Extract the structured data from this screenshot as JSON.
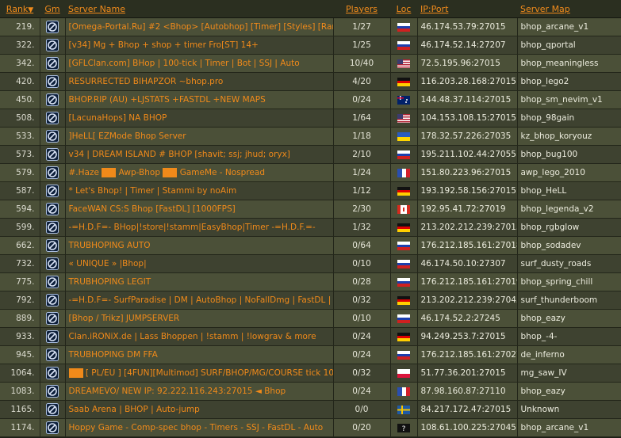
{
  "header": {
    "rank": "Rank",
    "rank_sort": "▼",
    "gm": "Gm",
    "name": "Server Name",
    "players": "Players",
    "loc": "Loc",
    "ip": "IP:Port",
    "map": "Server Map"
  },
  "flag_colors": {
    "ru": [
      "#ffffff",
      "#1c3fae",
      "#d02020"
    ],
    "us": [
      "#b22234",
      "#ffffff",
      "#3c3b6e"
    ],
    "de": [
      "#111111",
      "#dd0000",
      "#ffce00"
    ],
    "au": [
      "#012169",
      "#ffffff",
      "#e4002b"
    ],
    "ua": [
      "#2a5cbf",
      "#ffd500"
    ],
    "fr": [
      "#2a4fb0",
      "#ffffff",
      "#d3202a"
    ],
    "ca": [
      "#d52b1e",
      "#ffffff"
    ],
    "pl": [
      "#ffffff",
      "#dc143c"
    ],
    "se": [
      "#1f5aa6",
      "#f5c400"
    ],
    "unknown": [
      "#111111",
      "#ffffff"
    ]
  },
  "rows": [
    {
      "rank": "219.",
      "name": "[Omega-Portal.Ru] #2 <Bhop> [Autobhop] [Timer] [Styles] [Ranks]",
      "players": "1/27",
      "flag": "ru",
      "ip": "46.174.53.79:27015",
      "map": "bhop_arcane_v1"
    },
    {
      "rank": "322.",
      "name": "[v34] Mg + Bhop + shop + timer Fro[ST] 14+",
      "players": "1/25",
      "flag": "ru",
      "ip": "46.174.52.14:27207",
      "map": "bhop_qportal"
    },
    {
      "rank": "342.",
      "name": "[GFLClan.com] BHop | 100-tick | Timer | Bot | SSJ | Auto",
      "players": "10/40",
      "flag": "us",
      "ip": "72.5.195.96:27015",
      "map": "bhop_meaningless"
    },
    {
      "rank": "420.",
      "name": "RESURRECTED BIHAPZOR ~bhop.pro",
      "players": "4/20",
      "flag": "de",
      "ip": "116.203.28.168:27015",
      "map": "bhop_lego2"
    },
    {
      "rank": "450.",
      "name": "BHOP.RIP (AU) +LJSTATS +FASTDL +NEW MAPS",
      "players": "0/24",
      "flag": "au",
      "ip": "144.48.37.114:27015",
      "map": "bhop_sm_nevim_v1"
    },
    {
      "rank": "508.",
      "name": "[LacunaHops] NA BHOP",
      "players": "1/64",
      "flag": "us",
      "ip": "104.153.108.15:27015",
      "map": "bhop_98gain"
    },
    {
      "rank": "533.",
      "name": "]HeLL[ EZMode Bhop Server",
      "players": "1/18",
      "flag": "ua",
      "ip": "178.32.57.226:27035",
      "map": "kz_bhop_koryouz"
    },
    {
      "rank": "573.",
      "name": "v34 | DREAM ISLAND # BHOP [shavit; ssj; jhud; oryx]",
      "players": "2/10",
      "flag": "ru",
      "ip": "195.211.102.44:27055",
      "map": "bhop_bug100"
    },
    {
      "rank": "579.",
      "name": "#.Haze",
      "name_mid": "Awp-Bhop",
      "name_end": "GameMe - Nospread",
      "players": "1/24",
      "flag": "fr",
      "ip": "151.80.223.96:27015",
      "map": "awp_lego_2010"
    },
    {
      "rank": "587.",
      "name": "* Let's Bhop! | Timer | Stammi by noAim",
      "players": "1/12",
      "flag": "de",
      "ip": "193.192.58.156:27015",
      "map": "bhop_HeLL"
    },
    {
      "rank": "594.",
      "name": "FaceWAN CS:S Bhop [FastDL] [1000FPS]",
      "players": "2/30",
      "flag": "ca",
      "ip": "192.95.41.72:27019",
      "map": "bhop_legenda_v2"
    },
    {
      "rank": "599.",
      "name": "-=H.D.F=- BHop|!store|!stamm|EasyBhop|Timer -=H.D.F.=-",
      "players": "1/32",
      "flag": "de",
      "ip": "213.202.212.239:27015",
      "map": "bhop_rgbglow"
    },
    {
      "rank": "662.",
      "name": "TRUBHOPING AUTO",
      "players": "0/64",
      "flag": "ru",
      "ip": "176.212.185.161:27018",
      "map": "bhop_sodadev"
    },
    {
      "rank": "732.",
      "name": "« UNIQUE » |Bhop|",
      "players": "0/10",
      "flag": "ru",
      "ip": "46.174.50.10:27307",
      "map": "surf_dusty_roads"
    },
    {
      "rank": "775.",
      "name": "TRUBHOPING LEGIT",
      "players": "0/28",
      "flag": "ru",
      "ip": "176.212.185.161:27019",
      "map": "bhop_spring_chill"
    },
    {
      "rank": "792.",
      "name": "-=H.D.F=- SurfParadise | DM | AutoBhop | NoFallDmg | FastDL | !",
      "players": "0/32",
      "flag": "de",
      "ip": "213.202.212.239:27045",
      "map": "surf_thunderboom"
    },
    {
      "rank": "889.",
      "name": "[Bhop / Trikz] JUMPSERVER",
      "players": "0/10",
      "flag": "ru",
      "ip": "46.174.52.2:27245",
      "map": "bhop_eazy"
    },
    {
      "rank": "933.",
      "name": "Clan.iRONiX.de | Lass Bhoppen | !stamm | !lowgrav & more",
      "players": "0/24",
      "flag": "de",
      "ip": "94.249.253.7:27015",
      "map": "bhop_-4-"
    },
    {
      "rank": "945.",
      "name": "TRUBHOPING DM FFA",
      "players": "0/24",
      "flag": "ru",
      "ip": "176.212.185.161:27027",
      "map": "de_inferno"
    },
    {
      "rank": "1064.",
      "name": "[ PL/EU ] [4FUN][Multimod] SURF/BHOP/MG/COURSE tick 100",
      "players": "0/32",
      "flag": "pl",
      "ip": "51.77.36.201:27015",
      "map": "mg_saw_IV"
    },
    {
      "rank": "1083.",
      "name": "DREAMEVO/ NEW IP: 92.222.116.243:27015 ◄ Bhop",
      "players": "0/24",
      "flag": "fr",
      "ip": "87.98.160.87:27110",
      "map": "bhop_eazy"
    },
    {
      "rank": "1165.",
      "name": "Saab Arena | BHOP | Auto-jump",
      "players": "0/0",
      "flag": "se",
      "ip": "84.217.172.47:27015",
      "map": "Unknown"
    },
    {
      "rank": "1174.",
      "name": "Hoppy Game - Comp-spec bhop - Timers - SSJ - FastDL - Auto",
      "players": "0/20",
      "flag": "unknown",
      "flag_text": "?",
      "ip": "108.61.100.225:27045",
      "map": "bhop_arcane_v1"
    }
  ]
}
